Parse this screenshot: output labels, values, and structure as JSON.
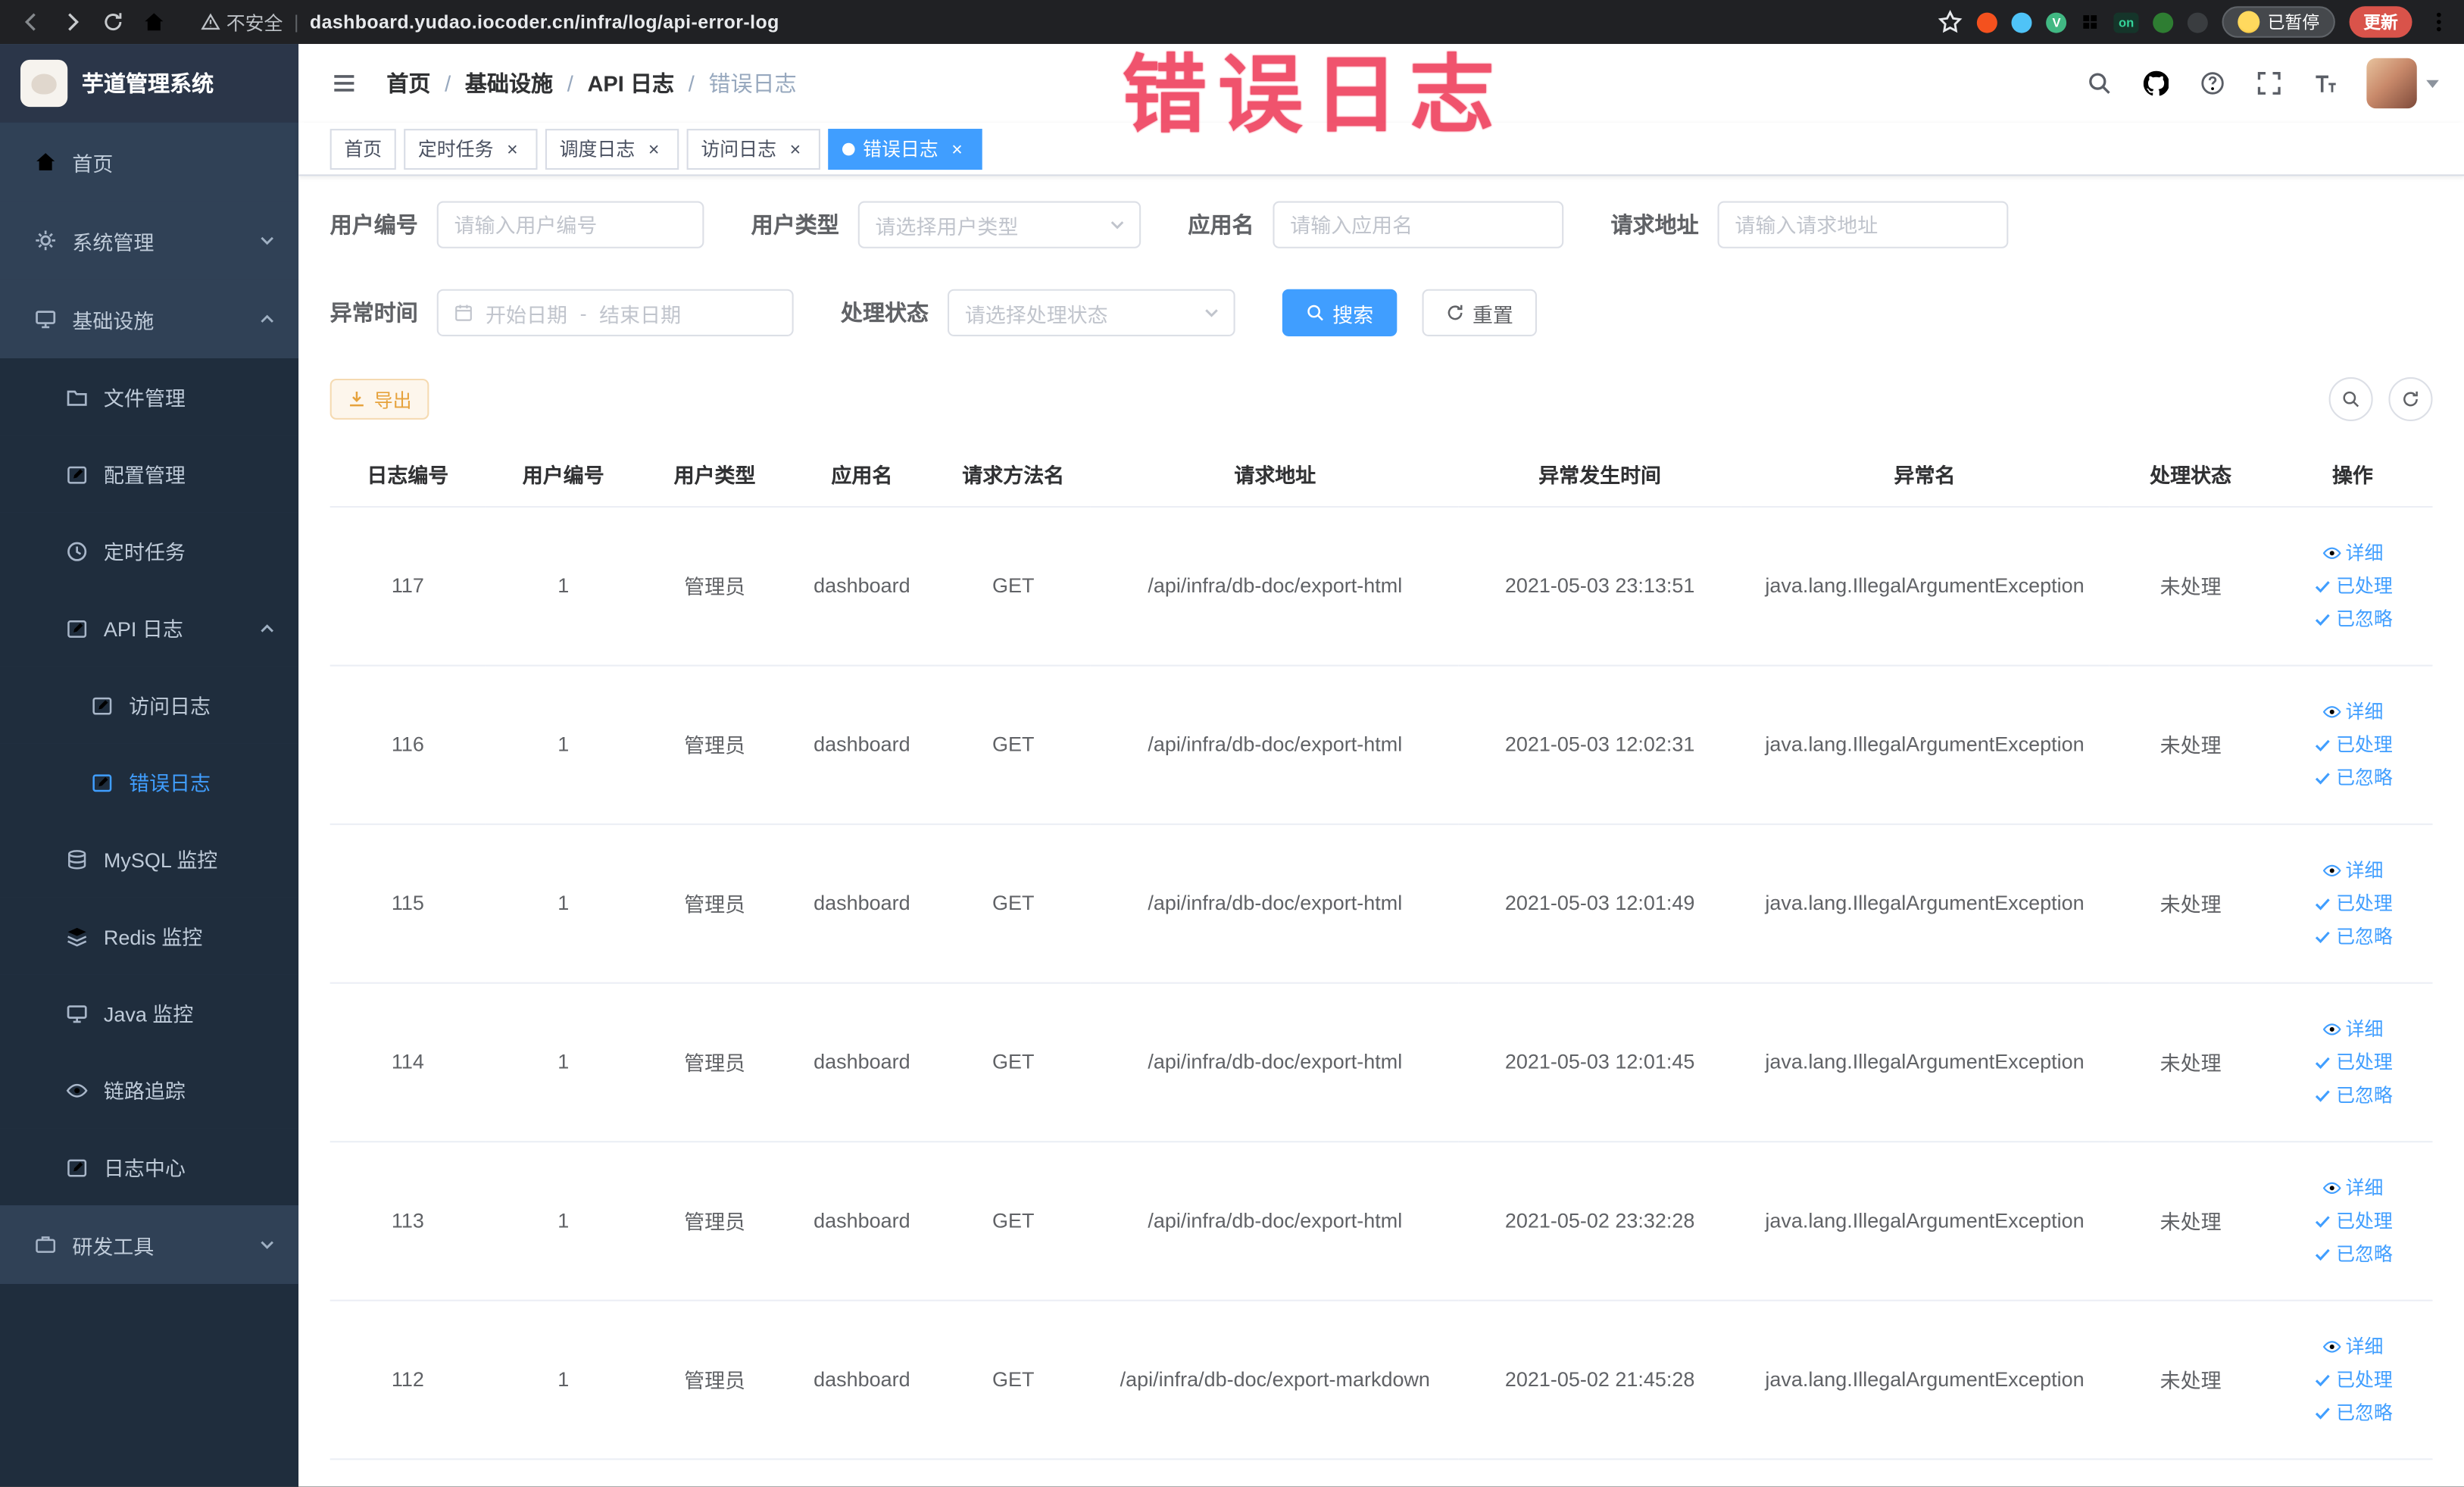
{
  "browser": {
    "security_label": "不安全",
    "url": "dashboard.yudao.iocoder.cn/infra/log/api-error-log",
    "extension_badge_on": "on",
    "extension_v_letter": "V",
    "paused_button": "已暂停",
    "update_button": "更新"
  },
  "annotation": {
    "text": "错误日志"
  },
  "sidebar": {
    "logo_title": "芋道管理系统",
    "items": [
      {
        "label": "首页"
      },
      {
        "label": "系统管理"
      },
      {
        "label": "基础设施"
      },
      {
        "label": "文件管理"
      },
      {
        "label": "配置管理"
      },
      {
        "label": "定时任务"
      },
      {
        "label": "API 日志"
      },
      {
        "label": "访问日志"
      },
      {
        "label": "错误日志"
      },
      {
        "label": "MySQL 监控"
      },
      {
        "label": "Redis 监控"
      },
      {
        "label": "Java 监控"
      },
      {
        "label": "链路追踪"
      },
      {
        "label": "日志中心"
      },
      {
        "label": "研发工具"
      }
    ]
  },
  "breadcrumb": {
    "items": [
      "首页",
      "基础设施",
      "API 日志",
      "错误日志"
    ]
  },
  "tabs": [
    {
      "label": "首页"
    },
    {
      "label": "定时任务"
    },
    {
      "label": "调度日志"
    },
    {
      "label": "访问日志"
    },
    {
      "label": "错误日志"
    }
  ],
  "filters": {
    "user_id": {
      "label": "用户编号",
      "placeholder": "请输入用户编号"
    },
    "user_type": {
      "label": "用户类型",
      "placeholder": "请选择用户类型"
    },
    "app_name": {
      "label": "应用名",
      "placeholder": "请输入应用名"
    },
    "request_url": {
      "label": "请求地址",
      "placeholder": "请输入请求地址"
    },
    "exception_time": {
      "label": "异常时间",
      "start_placeholder": "开始日期",
      "separator": "-",
      "end_placeholder": "结束日期"
    },
    "process_status": {
      "label": "处理状态",
      "placeholder": "请选择处理状态"
    },
    "search_button": "搜索",
    "reset_button": "重置"
  },
  "toolbar": {
    "export_button": "导出"
  },
  "table": {
    "columns": [
      "日志编号",
      "用户编号",
      "用户类型",
      "应用名",
      "请求方法名",
      "请求地址",
      "异常发生时间",
      "异常名",
      "处理状态",
      "操作"
    ],
    "actions": {
      "detail": "详细",
      "processed": "已处理",
      "ignore": "已忽略"
    },
    "rows": [
      {
        "id": "117",
        "user_id": "1",
        "user_type": "管理员",
        "app": "dashboard",
        "method": "GET",
        "url": "/api/infra/db-doc/export-html",
        "time": "2021-05-03 23:13:51",
        "exception": "java.lang.IllegalArgumentException",
        "status": "未处理"
      },
      {
        "id": "116",
        "user_id": "1",
        "user_type": "管理员",
        "app": "dashboard",
        "method": "GET",
        "url": "/api/infra/db-doc/export-html",
        "time": "2021-05-03 12:02:31",
        "exception": "java.lang.IllegalArgumentException",
        "status": "未处理"
      },
      {
        "id": "115",
        "user_id": "1",
        "user_type": "管理员",
        "app": "dashboard",
        "method": "GET",
        "url": "/api/infra/db-doc/export-html",
        "time": "2021-05-03 12:01:49",
        "exception": "java.lang.IllegalArgumentException",
        "status": "未处理"
      },
      {
        "id": "114",
        "user_id": "1",
        "user_type": "管理员",
        "app": "dashboard",
        "method": "GET",
        "url": "/api/infra/db-doc/export-html",
        "time": "2021-05-03 12:01:45",
        "exception": "java.lang.IllegalArgumentException",
        "status": "未处理"
      },
      {
        "id": "113",
        "user_id": "1",
        "user_type": "管理员",
        "app": "dashboard",
        "method": "GET",
        "url": "/api/infra/db-doc/export-html",
        "time": "2021-05-02 23:32:28",
        "exception": "java.lang.IllegalArgumentException",
        "status": "未处理"
      },
      {
        "id": "112",
        "user_id": "1",
        "user_type": "管理员",
        "app": "dashboard",
        "method": "GET",
        "url": "/api/infra/db-doc/export-markdown",
        "time": "2021-05-02 21:45:28",
        "exception": "java.lang.IllegalArgumentException",
        "status": "未处理"
      }
    ]
  },
  "colors": {
    "primary": "#409eff",
    "warning": "#e6a23c",
    "annotation": "#ef4663",
    "sidebar_bg": "#304156"
  }
}
